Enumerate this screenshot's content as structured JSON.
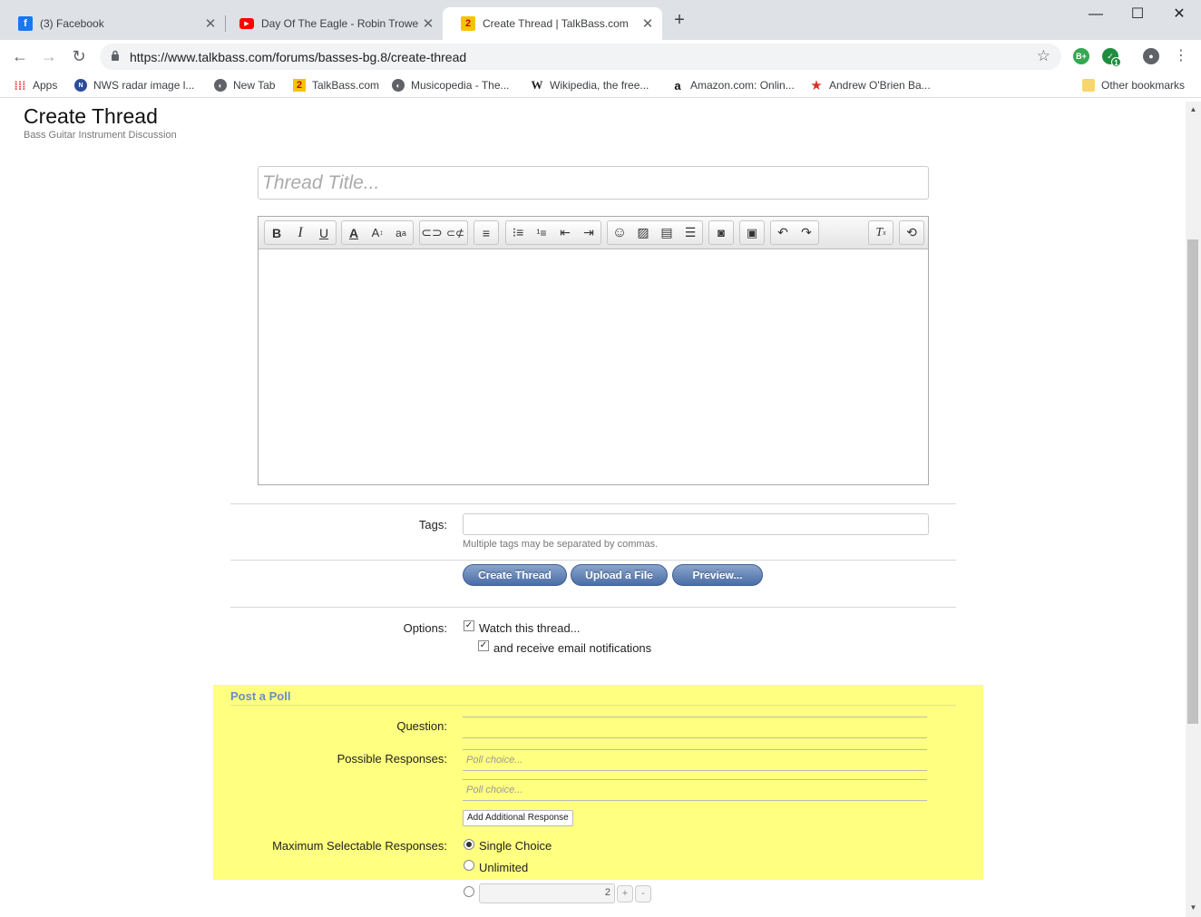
{
  "browser": {
    "tabs": [
      {
        "title": "(3) Facebook",
        "active": false
      },
      {
        "title": "Day Of The Eagle - Robin Trower",
        "active": false
      },
      {
        "title": "Create Thread | TalkBass.com",
        "active": true
      }
    ],
    "new_tab_glyph": "+",
    "window_controls": {
      "minimize": "—",
      "maximize": "☐",
      "close": "✕"
    },
    "url": "https://www.talkbass.com/forums/basses-bg.8/create-thread",
    "bookmarks": [
      {
        "label": "Apps",
        "icon": "apps-grid-icon"
      },
      {
        "label": "NWS radar image l...",
        "icon": "nws-icon"
      },
      {
        "label": "New Tab",
        "icon": "globe-icon"
      },
      {
        "label": "TalkBass.com",
        "icon": "talkbass-icon"
      },
      {
        "label": "Musicopedia - The...",
        "icon": "globe-icon"
      },
      {
        "label": "Wikipedia, the free...",
        "icon": "wikipedia-icon"
      },
      {
        "label": "Amazon.com: Onlin...",
        "icon": "amazon-icon"
      },
      {
        "label": "Andrew O'Brien Ba...",
        "icon": "star-bookmark-icon"
      }
    ],
    "other_bookmarks": "Other bookmarks",
    "extension_badge": "1",
    "extension_label": "B+"
  },
  "page": {
    "title": "Create Thread",
    "subtitle": "Bass Guitar Instrument Discussion",
    "thread_title_placeholder": "Thread Title..."
  },
  "editor_toolbar": [
    [
      "bold-icon",
      "italic-icon",
      "underline-icon"
    ],
    [
      "font-color-icon",
      "font-size-icon",
      "font-family-icon"
    ],
    [
      "link-icon",
      "unlink-icon"
    ],
    [
      "align-left-icon"
    ],
    [
      "bullet-list-icon",
      "numbered-list-icon",
      "outdent-icon",
      "indent-icon"
    ],
    [
      "smiley-icon",
      "image-icon",
      "media-icon",
      "insert-icon"
    ],
    [
      "camera-icon"
    ],
    [
      "save-draft-icon"
    ],
    [
      "undo-icon",
      "redo-icon"
    ],
    [
      "remove-format-icon"
    ],
    [
      "toggle-bbcode-icon"
    ]
  ],
  "form": {
    "tags_label": "Tags:",
    "tags_value": "",
    "tags_hint": "Multiple tags may be separated by commas.",
    "buttons": {
      "create": "Create Thread",
      "upload": "Upload a File",
      "preview": "Preview..."
    },
    "options_label": "Options:",
    "watch_thread": {
      "label": "Watch this thread...",
      "checked": true
    },
    "email_notify": {
      "label": "and receive email notifications",
      "checked": true
    }
  },
  "poll": {
    "heading": "Post a Poll",
    "question_label": "Question:",
    "question_value": "",
    "responses_label": "Possible Responses:",
    "response_placeholder": "Poll choice...",
    "add_response": "Add Additional Response",
    "max_label": "Maximum Selectable Responses:",
    "single_choice": "Single Choice",
    "unlimited": "Unlimited",
    "selected": "single",
    "max_value": "2",
    "plus": "+",
    "minus": "-"
  }
}
